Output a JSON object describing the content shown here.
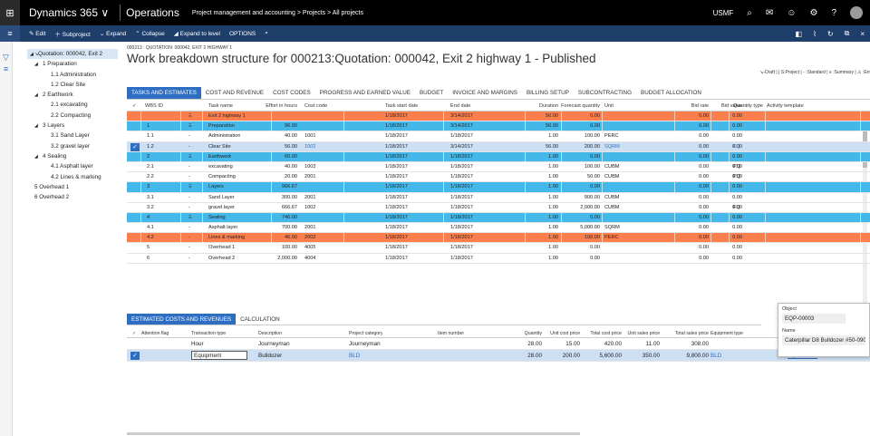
{
  "topbar": {
    "waffle": "waffle-icon",
    "app": "Dynamics 365 ∨",
    "module": "Operations",
    "breadcrumb": "Project management and accounting  >  Projects  >  All projects",
    "company": "USMF"
  },
  "actions": {
    "edit": "Edit",
    "subproject": "Subproject",
    "expand": "Expand",
    "collapse": "Collapse",
    "expand_level": "Expand to level",
    "options": "OPTIONS"
  },
  "page": {
    "crumb": "000213 : QUOTATION: 000042, EXIT 2 HIGHWAY 1",
    "title": "Work breakdown structure for 000213:Quotation: 000042, Exit 2 highway 1 - Published",
    "legend": "↘-Draft |  | S:Project | - :Standard |  ≡ :Summary | ⚠ :Err"
  },
  "tree": [
    {
      "label": "Quotation: 000042, Exit 2",
      "depth": "d0",
      "toggle": "◢ ↘",
      "sel": true
    },
    {
      "label": "1 Preparation",
      "depth": "d1",
      "toggle": "◢"
    },
    {
      "label": "1.1 Administration",
      "depth": "d2"
    },
    {
      "label": "1.2 Clear Site",
      "depth": "d2"
    },
    {
      "label": "2 Earthwork",
      "depth": "d1",
      "toggle": "◢"
    },
    {
      "label": "2.1 excavating",
      "depth": "d2"
    },
    {
      "label": "2.2 Compacting",
      "depth": "d2"
    },
    {
      "label": "3 Layers",
      "depth": "d1",
      "toggle": "◢"
    },
    {
      "label": "3.1 Sand Layer",
      "depth": "d2"
    },
    {
      "label": "3.2 gravel layer",
      "depth": "d2"
    },
    {
      "label": "4 Sealing",
      "depth": "d1",
      "toggle": "◢"
    },
    {
      "label": "4.1 Asphalt layer",
      "depth": "d2"
    },
    {
      "label": "4.2 Lines & marking",
      "depth": "d2"
    },
    {
      "label": "5 Overhead 1",
      "depth": "d1"
    },
    {
      "label": "6 Overhead 2",
      "depth": "d1"
    }
  ],
  "tabs": [
    "TASKS AND ESTIMATES",
    "COST AND REVENUE",
    "COST CODES",
    "PROGRESS AND EARNED VALUE",
    "BUDGET",
    "INVOICE AND MARGINS",
    "BILLING SETUP",
    "SUBCONTRACTING",
    "BUDGET ALLOCATION"
  ],
  "wbs_headers": {
    "check": "✓",
    "wbs": "WBS ID",
    "task": "Task name",
    "effort": "Effort in hours",
    "code": "Cost code",
    "start": "Task start date",
    "end": "End date",
    "duration": "Duration",
    "fqty": "Forecast quantity",
    "unit": "Unit",
    "bidrate": "Bid rate",
    "bidval": "Bid value",
    "qtytype": "Quantity type",
    "template": "Activity template"
  },
  "wbs_rows": [
    {
      "wbs": "",
      "sym": "Ξ",
      "task": "Exit 2 highway 1",
      "effort": "",
      "code": "",
      "start": "1/18/2017",
      "end": "3/14/2017",
      "duration": "56.00",
      "fqty": "0.00",
      "unit": "",
      "bidrate": "0.00",
      "bidval": "0.00",
      "qtytype": "",
      "style": "orange"
    },
    {
      "wbs": "1",
      "sym": "Ξ",
      "task": "Preparation",
      "effort": "96.00",
      "code": "",
      "start": "1/18/2017",
      "end": "3/14/2017",
      "duration": "56.00",
      "fqty": "0.00",
      "unit": "",
      "bidrate": "0.00",
      "bidval": "0.00",
      "qtytype": "",
      "style": "blue"
    },
    {
      "wbs": "1.1",
      "sym": "-",
      "task": "Administration",
      "effort": "40.00",
      "code": "1001",
      "start": "1/18/2017",
      "end": "1/18/2017",
      "duration": "1.00",
      "fqty": "100.00",
      "unit": "PERC",
      "bidrate": "0.00",
      "bidval": "0.00",
      "qtytype": "",
      "style": ""
    },
    {
      "wbs": "1.2",
      "sym": "-",
      "task": "Clear Site",
      "effort": "56.00",
      "code": "1002",
      "start": "1/18/2017",
      "end": "3/14/2017",
      "duration": "56.00",
      "fqty": "200.00",
      "unit": "SQRM",
      "bidrate": "0.00",
      "bidval": "0.00",
      "qtytype": "FQ",
      "style": "sel"
    },
    {
      "wbs": "2",
      "sym": "Ξ",
      "task": "Earthwork",
      "effort": "60.00",
      "code": "",
      "start": "1/18/2017",
      "end": "1/18/2017",
      "duration": "1.00",
      "fqty": "0.00",
      "unit": "",
      "bidrate": "0.00",
      "bidval": "0.00",
      "qtytype": "",
      "style": "blue"
    },
    {
      "wbs": "2.1",
      "sym": "-",
      "task": "excavating",
      "effort": "40.00",
      "code": "1003",
      "start": "1/18/2017",
      "end": "1/18/2017",
      "duration": "1.00",
      "fqty": "100.00",
      "unit": "CUBM",
      "bidrate": "0.00",
      "bidval": "0.00",
      "qtytype": "PQ",
      "style": ""
    },
    {
      "wbs": "2.2",
      "sym": "-",
      "task": "Compacting",
      "effort": "20.00",
      "code": "2001",
      "start": "1/18/2017",
      "end": "1/18/2017",
      "duration": "1.00",
      "fqty": "50.00",
      "unit": "CUBM",
      "bidrate": "0.00",
      "bidval": "0.00",
      "qtytype": "PQ",
      "style": ""
    },
    {
      "wbs": "3",
      "sym": "Ξ",
      "task": "Layers",
      "effort": "966.67",
      "code": "",
      "start": "1/18/2017",
      "end": "1/18/2017",
      "duration": "1.00",
      "fqty": "0.00",
      "unit": "",
      "bidrate": "0.00",
      "bidval": "0.00",
      "qtytype": "",
      "style": "blue"
    },
    {
      "wbs": "3.1",
      "sym": "-",
      "task": "Sand Layer",
      "effort": "300.00",
      "code": "2001",
      "start": "1/18/2017",
      "end": "1/18/2017",
      "duration": "1.00",
      "fqty": "900.00",
      "unit": "CUBM",
      "bidrate": "0.00",
      "bidval": "0.00",
      "qtytype": "",
      "style": ""
    },
    {
      "wbs": "3.2",
      "sym": "-",
      "task": "gravel layer",
      "effort": "666.67",
      "code": "1002",
      "start": "1/18/2017",
      "end": "1/18/2017",
      "duration": "1.00",
      "fqty": "2,000.00",
      "unit": "CUBM",
      "bidrate": "0.00",
      "bidval": "0.00",
      "qtytype": "FQ",
      "style": ""
    },
    {
      "wbs": "4",
      "sym": "Ξ",
      "task": "Sealing",
      "effort": "746.00",
      "code": "",
      "start": "1/18/2017",
      "end": "1/18/2017",
      "duration": "1.00",
      "fqty": "0.00",
      "unit": "",
      "bidrate": "0.00",
      "bidval": "0.00",
      "qtytype": "",
      "style": "blue"
    },
    {
      "wbs": "4.1",
      "sym": "-",
      "task": "Asphalt layer",
      "effort": "700.00",
      "code": "2001",
      "start": "1/18/2017",
      "end": "1/18/2017",
      "duration": "1.00",
      "fqty": "5,000.00",
      "unit": "SQRM",
      "bidrate": "0.00",
      "bidval": "0.00",
      "qtytype": "",
      "style": ""
    },
    {
      "wbs": "4.2",
      "sym": "-",
      "task": "Lines & marking",
      "effort": "46.00",
      "code": "2002",
      "start": "1/18/2017",
      "end": "1/18/2017",
      "duration": "1.00",
      "fqty": "100.00",
      "unit": "PERC",
      "bidrate": "0.00",
      "bidval": "0.00",
      "qtytype": "",
      "style": "orange"
    },
    {
      "wbs": "5",
      "sym": "-",
      "task": "Overhead 1",
      "effort": "100.00",
      "code": "4005",
      "start": "1/18/2017",
      "end": "1/18/2017",
      "duration": "1.00",
      "fqty": "0.00",
      "unit": "",
      "bidrate": "0.00",
      "bidval": "0.00",
      "qtytype": "",
      "style": ""
    },
    {
      "wbs": "6",
      "sym": "-",
      "task": "Overhead 2",
      "effort": "2,000.00",
      "code": "4004",
      "start": "1/18/2017",
      "end": "1/18/2017",
      "duration": "1.00",
      "fqty": "0.00",
      "unit": "",
      "bidrate": "0.00",
      "bidval": "0.00",
      "qtytype": "",
      "style": ""
    }
  ],
  "tabs2": [
    "ESTIMATED COSTS AND REVENUES",
    "CALCULATION"
  ],
  "cost_headers": {
    "check": "✓",
    "flag": "Attention flag",
    "ttype": "Transaction type",
    "desc": "Description",
    "cat": "Project category",
    "item": "Item number",
    "qty": "Quantity",
    "ucp": "Unit cost price",
    "tcp": "Total cost price",
    "usp": "Unit sales price",
    "tsp": "Total sales price",
    "eq": "Equipment type"
  },
  "cost_rows": [
    {
      "ttype": "Hour",
      "desc": "Journeyman",
      "cat": "Journeyman",
      "qty": "28.00",
      "ucp": "15.00",
      "tcp": "420.00",
      "usp": "11.00",
      "tsp": "308.00",
      "eq": "",
      "res": "",
      "sel": false
    },
    {
      "ttype": "Equipment",
      "desc": "Bulldozer",
      "cat": "BLD",
      "qty": "28.00",
      "ucp": "200.00",
      "tcp": "5,600.00",
      "usp": "350.00",
      "tsp": "9,800.00",
      "eq": "BLD",
      "res": "EQP-00003",
      "extra": "40",
      "sel": true
    }
  ],
  "popup": {
    "object_label": "Object",
    "object_value": "EQP-00003",
    "name_label": "Name",
    "name_value": "Caterpillar D8 Bulldozer #50-090"
  }
}
